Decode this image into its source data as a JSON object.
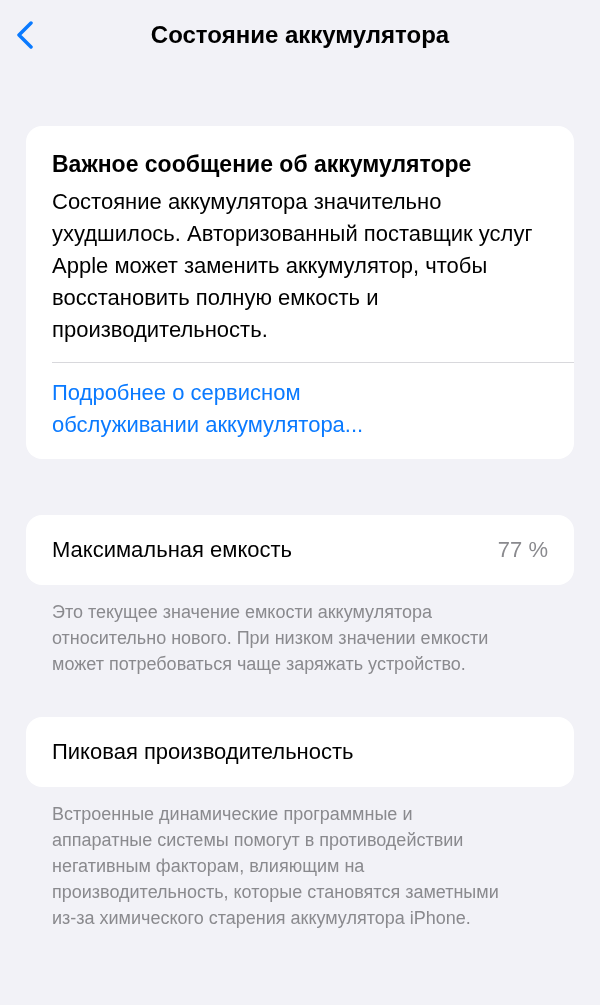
{
  "nav": {
    "title": "Состояние аккумулятора"
  },
  "message": {
    "title": "Важное сообщение об аккумуляторе",
    "body": "Состояние аккумулятора значительно ухудшилось. Авторизованный поставщик услуг Apple может заменить аккумулятор, чтобы восстановить полную емкость и производительность.",
    "link": "Подробнее о сервисном обслуживании аккумулятора..."
  },
  "capacity": {
    "label": "Максимальная емкость",
    "value": "77 %",
    "note": "Это текущее значение емкости аккумулятора относительно нового. При низком значении емкости может потребоваться чаще заряжать устройство."
  },
  "performance": {
    "label": "Пиковая производительность",
    "note": "Встроенные динамические программные и аппаратные системы помогут в противодействии негативным факторам, влияющим на производительность, которые становятся заметными из-за химического старения аккумулятора iPhone."
  }
}
